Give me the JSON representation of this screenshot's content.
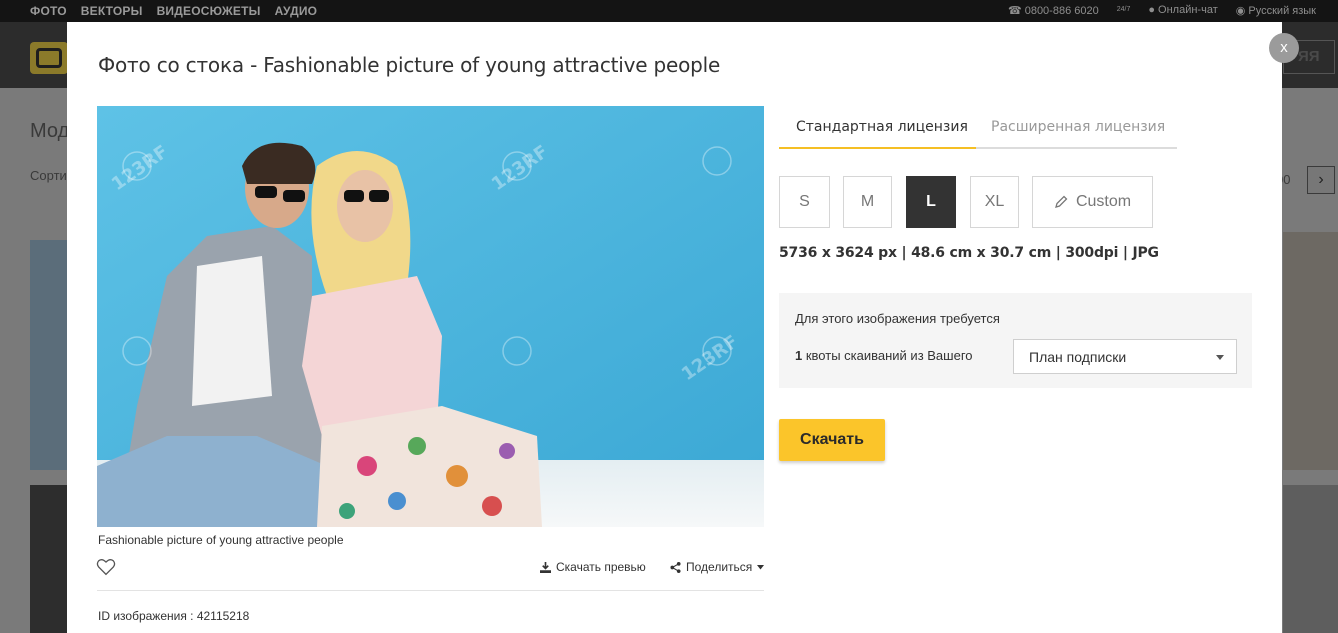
{
  "background": {
    "nav_items": [
      "ФОТО",
      "ВЕКТОРЫ",
      "ВИДЕОСЮЖЕТЫ",
      "АУДИО"
    ],
    "phone": "0800-886 6020",
    "support_hours": "24/7",
    "chat": "Онлайн-чат",
    "language": "Русский язык",
    "page_title": "Мод",
    "sort_label": "Сорти",
    "right_button": "ЯЯ",
    "pager_text": "00"
  },
  "modal": {
    "title": "Фото со стока - Fashionable picture of young attractive people",
    "close_label": "x",
    "caption": "Fashionable picture of young attractive people",
    "download_preview": "Скачать превью",
    "share": "Поделиться",
    "image_id": "ID изображения : 42115218",
    "watermark": "123RF"
  },
  "license": {
    "tabs": [
      "Стандартная лицензия",
      "Расширенная лицензия"
    ],
    "active_tab": 0,
    "sizes": [
      "S",
      "M",
      "L",
      "XL"
    ],
    "selected_size": "L",
    "custom_label": "Custom",
    "specs": "5736 x 3624 px | 48.6 cm x 30.7 cm | 300dpi | JPG",
    "quota_line1": "Для этого изображения требуется",
    "quota_count": "1",
    "quota_line2": "квоты скаиваний из Вашего",
    "plan_select": "План подписки",
    "download_button": "Скачать"
  },
  "colors": {
    "accent": "#fbc52a",
    "photo_sky": "#4fb6de"
  }
}
